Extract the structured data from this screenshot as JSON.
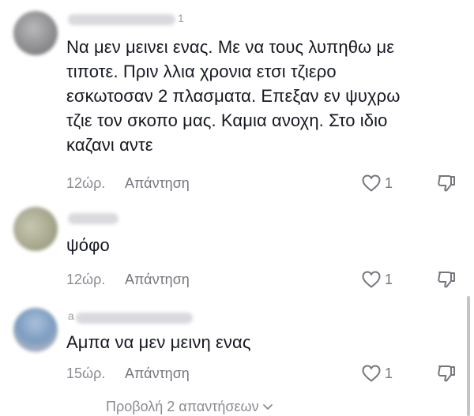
{
  "comments": [
    {
      "username_tail": "1",
      "text": "Να μεν μεινει ενας. Με να τους λυπηθω με\nτιποτε. Πριν λλια χρονια ετσι τζιερο\nεσκωτοσαν 2 πλασματα. Επεξαν εν ψυχρω\nτζιε τον σκοπο μας. Καμια ανοχη. Στο ιδιο\nκαζανι αντε",
      "time": "12ώρ.",
      "reply_label": "Απάντηση",
      "likes": "1",
      "avatar_color": "#8f8f92"
    },
    {
      "username_tail": "",
      "text": "ψόφο",
      "time": "12ώρ.",
      "reply_label": "Απάντηση",
      "likes": "1",
      "avatar_color": "#a8a98f"
    },
    {
      "username_tail": "a",
      "text": "Αμπα να μεν μεινη ενας",
      "time": "15ώρ.",
      "reply_label": "Απάντηση",
      "likes": "1",
      "avatar_color": "#7d9cc0"
    }
  ],
  "view_replies": {
    "label": "Προβολή 2 απαντήσεων",
    "icon": "chevron-down-icon"
  },
  "colors": {
    "text": "#161823",
    "meta": "#8a8b91",
    "background": "#ffffff"
  }
}
